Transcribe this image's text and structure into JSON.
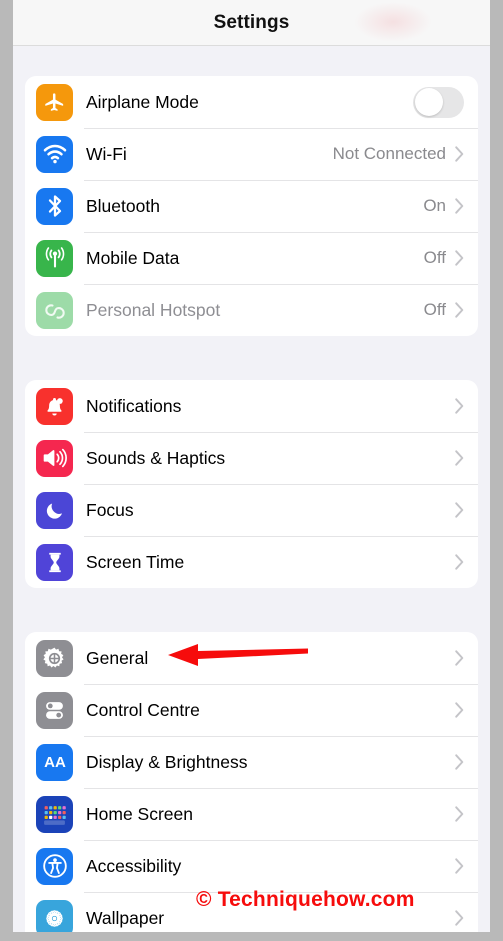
{
  "header": {
    "title": "Settings"
  },
  "groups": [
    {
      "name": "connectivity",
      "rows": [
        {
          "name": "airplane-mode",
          "label": "Airplane Mode",
          "icon": "airplane-icon",
          "icon_color": "#f5980c",
          "control": "toggle",
          "toggle_on": false,
          "dim": false
        },
        {
          "name": "wifi",
          "label": "Wi-Fi",
          "icon": "wifi-icon",
          "icon_color": "#1878f0",
          "value": "Not Connected",
          "control": "chevron",
          "dim": false
        },
        {
          "name": "bluetooth",
          "label": "Bluetooth",
          "icon": "bluetooth-icon",
          "icon_color": "#1878f0",
          "value": "On",
          "control": "chevron",
          "dim": false
        },
        {
          "name": "mobile-data",
          "label": "Mobile Data",
          "icon": "cellular-antenna-icon",
          "icon_color": "#38b54b",
          "value": "Off",
          "control": "chevron",
          "dim": false
        },
        {
          "name": "personal-hotspot",
          "label": "Personal Hotspot",
          "icon": "hotspot-link-icon",
          "icon_color": "#9ddba8",
          "value": "Off",
          "control": "chevron",
          "dim": true
        }
      ]
    },
    {
      "name": "alerts",
      "rows": [
        {
          "name": "notifications",
          "label": "Notifications",
          "icon": "bell-icon",
          "icon_color": "#f8312d",
          "control": "chevron",
          "dim": false
        },
        {
          "name": "sounds-haptics",
          "label": "Sounds & Haptics",
          "icon": "speaker-wave-icon",
          "icon_color": "#f5274f",
          "control": "chevron",
          "dim": false
        },
        {
          "name": "focus",
          "label": "Focus",
          "icon": "moon-icon",
          "icon_color": "#4b46d6",
          "control": "chevron",
          "dim": false
        },
        {
          "name": "screen-time",
          "label": "Screen Time",
          "icon": "hourglass-icon",
          "icon_color": "#5044d8",
          "control": "chevron",
          "dim": false
        }
      ]
    },
    {
      "name": "system",
      "rows": [
        {
          "name": "general",
          "label": "General",
          "icon": "gear-icon",
          "icon_color": "#8e8e93",
          "control": "chevron",
          "dim": false
        },
        {
          "name": "control-centre",
          "label": "Control Centre",
          "icon": "sliders-toggle-icon",
          "icon_color": "#8e8e93",
          "control": "chevron",
          "dim": false
        },
        {
          "name": "display-brightness",
          "label": "Display & Brightness",
          "icon": "aa-text-icon",
          "icon_color": "#1878f0",
          "control": "chevron",
          "dim": false
        },
        {
          "name": "home-screen",
          "label": "Home Screen",
          "icon": "app-grid-icon",
          "icon_color": "#1b43b8",
          "control": "chevron",
          "dim": false
        },
        {
          "name": "accessibility",
          "label": "Accessibility",
          "icon": "accessibility-person-icon",
          "icon_color": "#1878f0",
          "control": "chevron",
          "dim": false
        },
        {
          "name": "wallpaper",
          "label": "Wallpaper",
          "icon": "flower-wallpaper-icon",
          "icon_color": "#38a5dc",
          "control": "chevron",
          "dim": false
        }
      ]
    }
  ],
  "annotations": {
    "arrow": {
      "name": "red-arrow-pointing-to-general",
      "color": "#f60c0c",
      "direction": "left"
    },
    "watermark": {
      "text": "© Techniquehow.com",
      "color": "#f60c0c"
    }
  }
}
